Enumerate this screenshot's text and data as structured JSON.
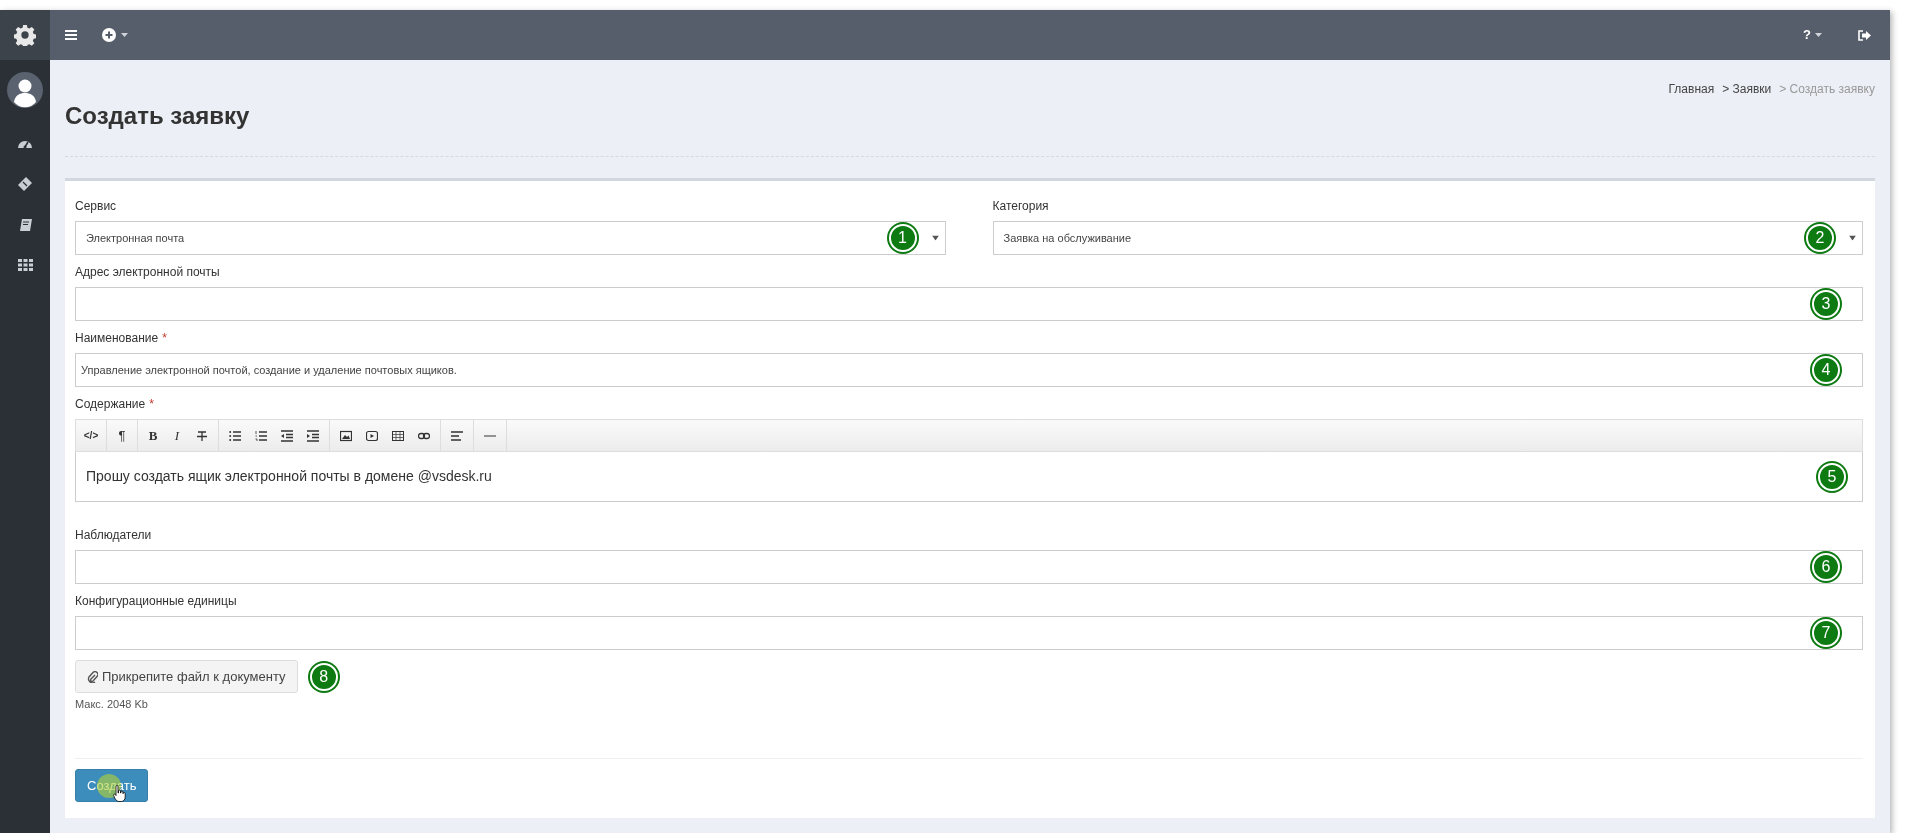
{
  "topbar": {
    "help": "?"
  },
  "page": {
    "title": "Создать заявку",
    "breadcrumbs": [
      {
        "label": "Главная",
        "current": false
      },
      {
        "label": "> Заявки",
        "current": false
      },
      {
        "label": "> Создать заявку",
        "current": true
      }
    ]
  },
  "form": {
    "rows": [
      [
        {
          "kind": "select",
          "label": "Сервис",
          "value": "Электронная почта",
          "callout": "1"
        },
        {
          "kind": "select",
          "label": "Категория",
          "value": "Заявка на обслуживание",
          "callout": "2"
        }
      ],
      [
        {
          "kind": "input",
          "label": "Адрес электронной почты",
          "callout": "3"
        }
      ],
      [
        {
          "kind": "input",
          "label": "Наименование",
          "required_mark": "*",
          "value": "Управление электронной почтой, создание и удаление почтовых ящиков.",
          "callout": "4"
        }
      ],
      [
        {
          "kind": "editor",
          "label": "Содержание",
          "required_mark": "*",
          "value": "Прошу создать ящик электронной почты в домене @vsdesk.ru",
          "callout": "5",
          "toolbar": [
            [
              {
                "kind": "code",
                "label": "</>"
              }
            ],
            [
              {
                "kind": "paragraph",
                "label": "¶"
              }
            ],
            [
              {
                "kind": "bold",
                "label": "B"
              },
              {
                "kind": "italic",
                "label": "I"
              },
              {
                "kind": "strike"
              }
            ],
            [
              {
                "kind": "ul"
              },
              {
                "kind": "ol"
              },
              {
                "kind": "outdent"
              },
              {
                "kind": "indent"
              }
            ],
            [
              {
                "kind": "image"
              },
              {
                "kind": "video"
              },
              {
                "kind": "table"
              },
              {
                "kind": "link"
              }
            ],
            [
              {
                "kind": "align"
              }
            ],
            [
              {
                "kind": "hr"
              }
            ]
          ]
        }
      ],
      [
        {
          "kind": "input",
          "label": "Наблюдатели",
          "callout": "6"
        }
      ],
      [
        {
          "kind": "input",
          "label": "Конфигурационные единицы",
          "callout": "7"
        }
      ]
    ],
    "attach": {
      "label": "Прикрепите файл к документу",
      "callout": "8",
      "note": "Макс. 2048 Kb"
    },
    "submit": {
      "label": "Создать"
    }
  }
}
